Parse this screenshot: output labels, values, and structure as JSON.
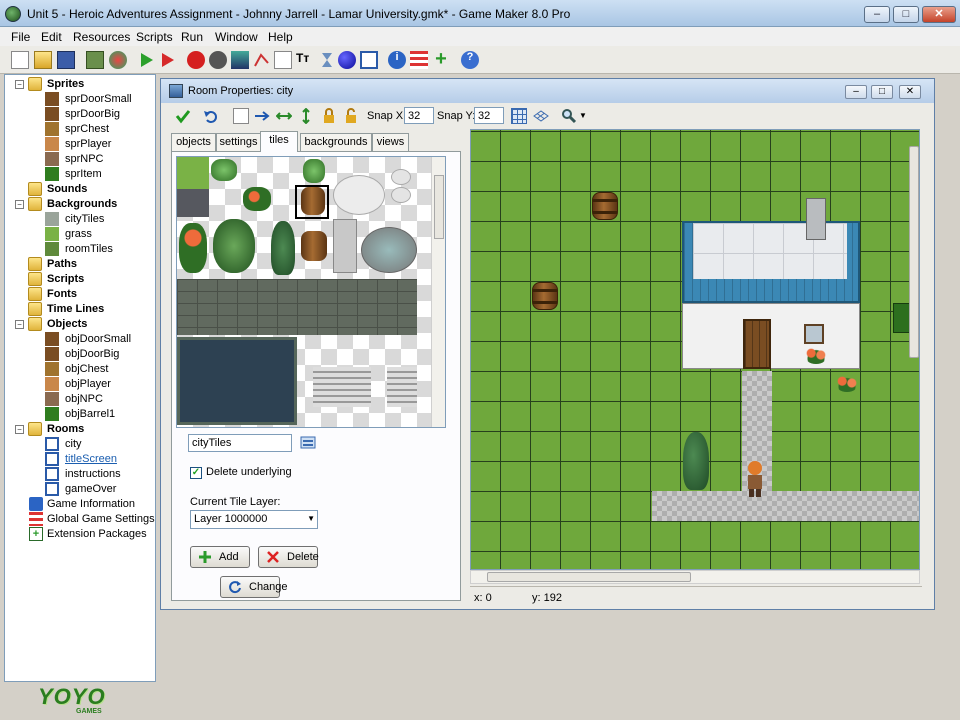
{
  "window": {
    "title": "Unit 5 - Heroic Adventures Assignment - Johnny Jarrell - Lamar University.gmk* - Game Maker 8.0 Pro",
    "minimize": "–",
    "maximize": "□",
    "close": "✕"
  },
  "menu": [
    "File",
    "Edit",
    "Resources",
    "Scripts",
    "Run",
    "Window",
    "Help"
  ],
  "toolbar_icons": [
    "new-icon",
    "open-icon",
    "save-icon",
    "export-icon",
    "publish-icon",
    "run-icon",
    "debug-icon",
    "sprite-icon",
    "sound-icon",
    "background-icon",
    "path-icon",
    "script-icon",
    "font-icon",
    "timeline-icon",
    "object-icon",
    "room-icon",
    "game-info-icon",
    "settings-icon",
    "extensions-icon",
    "help-icon"
  ],
  "tree": {
    "sprites": "Sprites",
    "sprite_items": [
      "sprDoorSmall",
      "sprDoorBig",
      "sprChest",
      "sprPlayer",
      "sprNPC",
      "sprItem"
    ],
    "sounds": "Sounds",
    "backgrounds": "Backgrounds",
    "background_items": [
      "cityTiles",
      "grass",
      "roomTiles"
    ],
    "paths": "Paths",
    "scripts": "Scripts",
    "fonts": "Fonts",
    "timelines": "Time Lines",
    "objects": "Objects",
    "object_items": [
      "objDoorSmall",
      "objDoorBig",
      "objChest",
      "objPlayer",
      "objNPC",
      "objBarrel1"
    ],
    "rooms": "Rooms",
    "room_items": [
      "city",
      "titleScreen",
      "instructions",
      "gameOver"
    ],
    "game_information": "Game Information",
    "global_settings": "Global Game Settings",
    "extension_packages": "Extension Packages"
  },
  "logo": {
    "text": "YOYO",
    "sub": "GAMES"
  },
  "room": {
    "title": "Room Properties: city",
    "snap_x_label": "Snap X:",
    "snap_x": "32",
    "snap_y_label": "Snap Y:",
    "snap_y": "32",
    "tabs": [
      "objects",
      "settings",
      "tiles",
      "backgrounds",
      "views"
    ],
    "active_tab": "tiles",
    "tileset": "cityTiles",
    "delete_underlying_label": "Delete underlying",
    "delete_underlying": true,
    "tile_layer_label": "Current Tile Layer:",
    "tile_layer": "Layer 1000000",
    "add_label": "Add",
    "delete_label": "Delete",
    "change_label": "Change",
    "status_x": "x: 0",
    "status_y": "y: 192"
  }
}
